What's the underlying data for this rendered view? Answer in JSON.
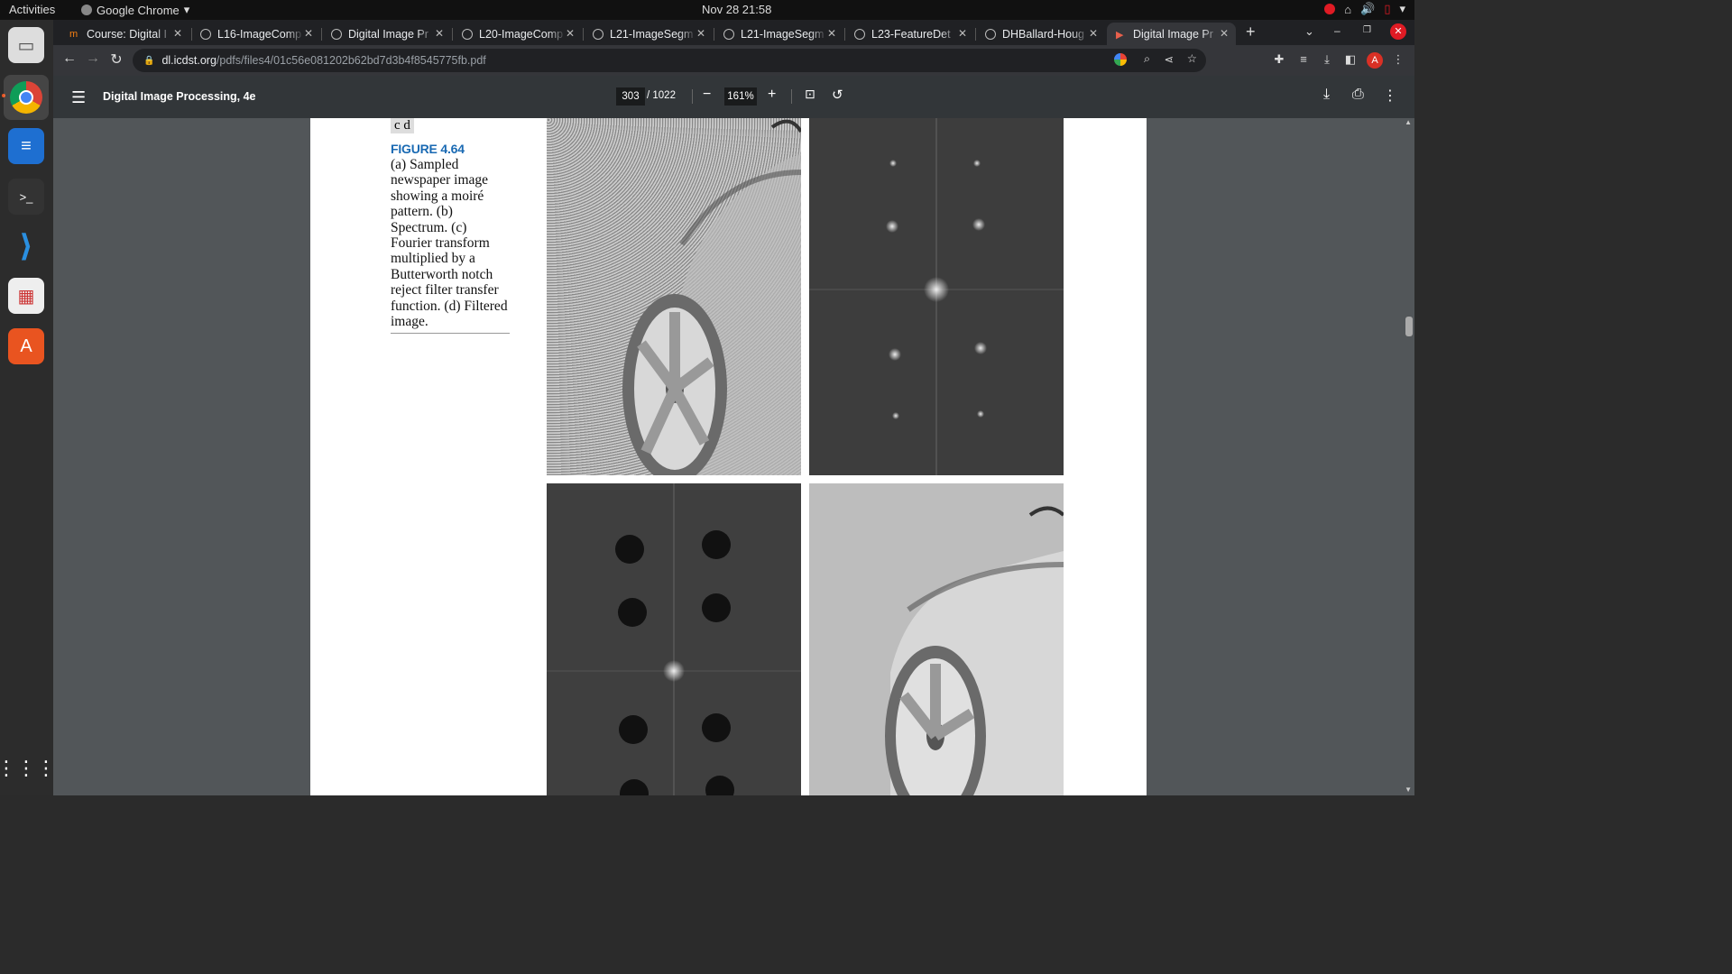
{
  "topbar": {
    "activities": "Activities",
    "app": "Google Chrome",
    "clock": "Nov 28  21:58"
  },
  "tabs": [
    {
      "title": "Course: Digital I"
    },
    {
      "title": "L16-ImageComp"
    },
    {
      "title": "Digital Image Pr"
    },
    {
      "title": "L20-ImageComp"
    },
    {
      "title": "L21-ImageSegm"
    },
    {
      "title": "L21-ImageSegm"
    },
    {
      "title": "L23-FeatureDet"
    },
    {
      "title": "DHBallard-Houg"
    },
    {
      "title": "Digital Image Pr"
    }
  ],
  "address": {
    "host": "dl.icdst.org",
    "path": "/pdfs/files4/01c56e081202b62bd7d3b4f8545775fb.pdf"
  },
  "pdf": {
    "title": "Digital Image Processing, 4e",
    "page": "303",
    "total": "/ 1022",
    "zoom": "161%"
  },
  "figure": {
    "labels": "c  d",
    "title": "FIGURE 4.64",
    "caption": " (a) Sampled newspaper image showing a moiré pattern. (b) Spectrum. (c) Fourier transform multiplied by a Butterworth notch reject filter transfer function. (d) Filtered image."
  },
  "icons": {
    "profile": "A"
  }
}
